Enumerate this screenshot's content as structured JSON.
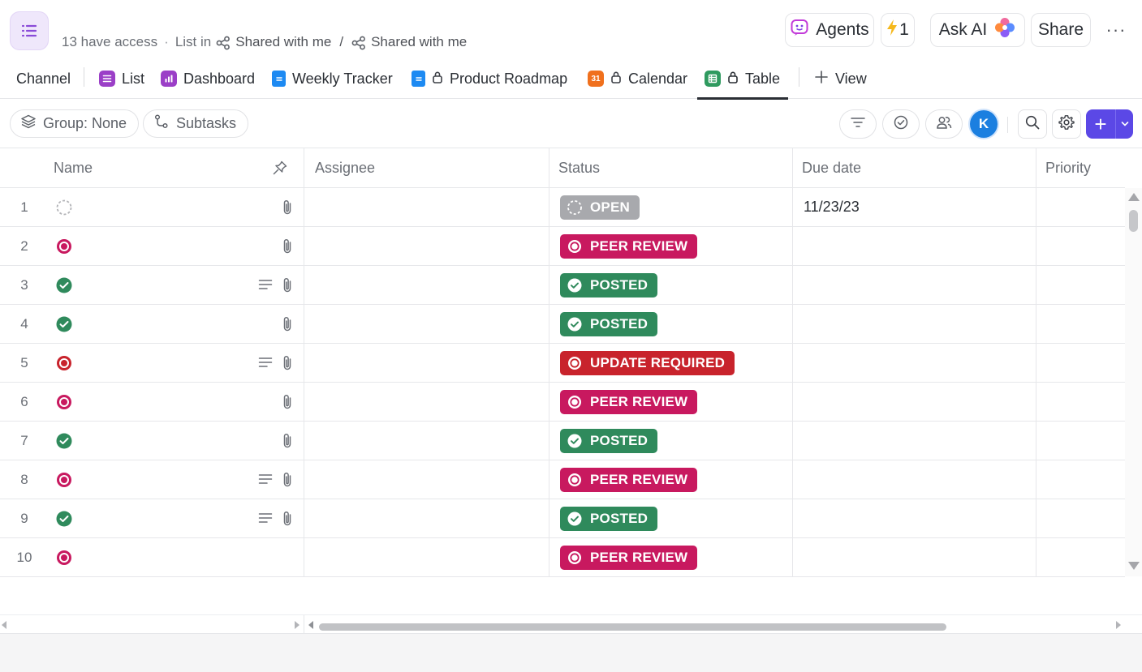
{
  "header": {
    "access_text": "13 have access",
    "list_in": "List in",
    "crumb1": "Shared with me",
    "crumb_sep": "/",
    "crumb2": "Shared with me",
    "agents_label": "Agents",
    "automations_count": "1",
    "ask_ai_label": "Ask AI",
    "share_label": "Share",
    "more_label": "···"
  },
  "tabs": [
    {
      "label": "Channel"
    },
    {
      "label": "List"
    },
    {
      "label": "Dashboard"
    },
    {
      "label": "Weekly Tracker"
    },
    {
      "label": "Product Roadmap"
    },
    {
      "label": "Calendar",
      "calendar_day": "31"
    },
    {
      "label": "Table"
    },
    {
      "label": "View"
    }
  ],
  "toolbar": {
    "group_label": "Group: None",
    "subtasks_label": "Subtasks",
    "avatar_initial": "K",
    "add_label": "+"
  },
  "table": {
    "columns": [
      "Name",
      "Assignee",
      "Status",
      "Due date",
      "Priority"
    ],
    "rows": [
      {
        "num": "1",
        "status": "OPEN",
        "due": "11/23/23"
      },
      {
        "num": "2",
        "status": "PEER REVIEW",
        "due": ""
      },
      {
        "num": "3",
        "status": "POSTED",
        "due": ""
      },
      {
        "num": "4",
        "status": "POSTED",
        "due": ""
      },
      {
        "num": "5",
        "status": "UPDATE REQUIRED",
        "due": ""
      },
      {
        "num": "6",
        "status": "PEER REVIEW",
        "due": ""
      },
      {
        "num": "7",
        "status": "POSTED",
        "due": ""
      },
      {
        "num": "8",
        "status": "PEER REVIEW",
        "due": ""
      },
      {
        "num": "9",
        "status": "POSTED",
        "due": ""
      },
      {
        "num": "10",
        "status": "PEER REVIEW",
        "due": ""
      }
    ]
  },
  "colors": {
    "open": "#a8a9ad",
    "peer_review": "#c8195f",
    "posted": "#2f8a5c",
    "update_required": "#c8232c",
    "accent": "#5b48e6"
  }
}
